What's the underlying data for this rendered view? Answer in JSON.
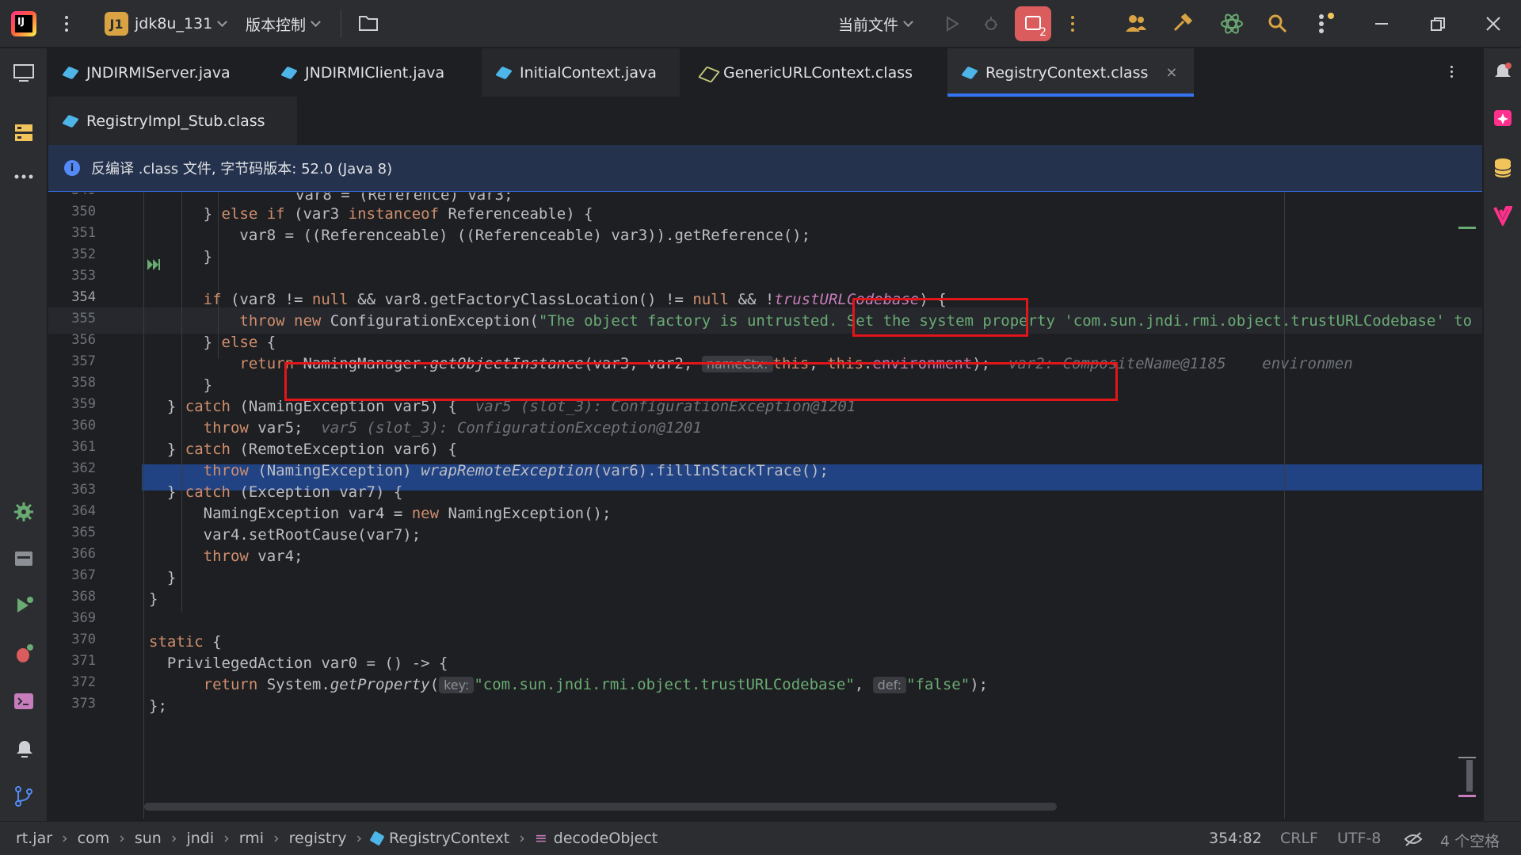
{
  "titlebar": {
    "project_badge": "J1",
    "project_name": "jdk8u_131",
    "vcs_label": "版本控制",
    "run_config": "当前文件",
    "stop_count": "2"
  },
  "tabs_row1": [
    {
      "label": "JNDIRMIServer.java"
    },
    {
      "label": "JNDIRMIClient.java"
    },
    {
      "label": "InitialContext.java"
    },
    {
      "label": "GenericURLContext.class"
    },
    {
      "label": "RegistryContext.class"
    }
  ],
  "tabs_row2": [
    {
      "label": "RegistryImpl_Stub.class"
    }
  ],
  "close_glyph": "×",
  "banner": {
    "info_glyph": "i",
    "text": "反编译 .class 文件, 字节码版本: 52.0 (Java 8)"
  },
  "editor": {
    "line_numbers": [
      "350",
      "351",
      "352",
      "353",
      "354",
      "355",
      "356",
      "357",
      "358",
      "359",
      "360",
      "361",
      "362",
      "363",
      "364",
      "365",
      "366",
      "367",
      "368",
      "369",
      "370",
      "371",
      "372"
    ],
    "partial_top": "var8 = (Reference) var3;",
    "partial_top_num": "349",
    "partial_bottom": "};",
    "partial_bottom_num": "373",
    "inlays": {
      "namectx": "nameCtx:",
      "key": "key:",
      "def": "def:"
    },
    "hints": {
      "l357": "var2: CompositeName@1185    environmen",
      "l359": "var5 (slot_3): ConfigurationException@1201",
      "l360": "var5 (slot_3): ConfigurationException@1201"
    }
  },
  "statusbar": {
    "breadcrumbs": [
      "rt.jar",
      "com",
      "sun",
      "jndi",
      "rmi",
      "registry",
      "RegistryContext",
      "decodeObject"
    ],
    "position": "354:82",
    "line_sep": "CRLF",
    "encoding": "UTF-8",
    "indent": "4 个空格"
  }
}
